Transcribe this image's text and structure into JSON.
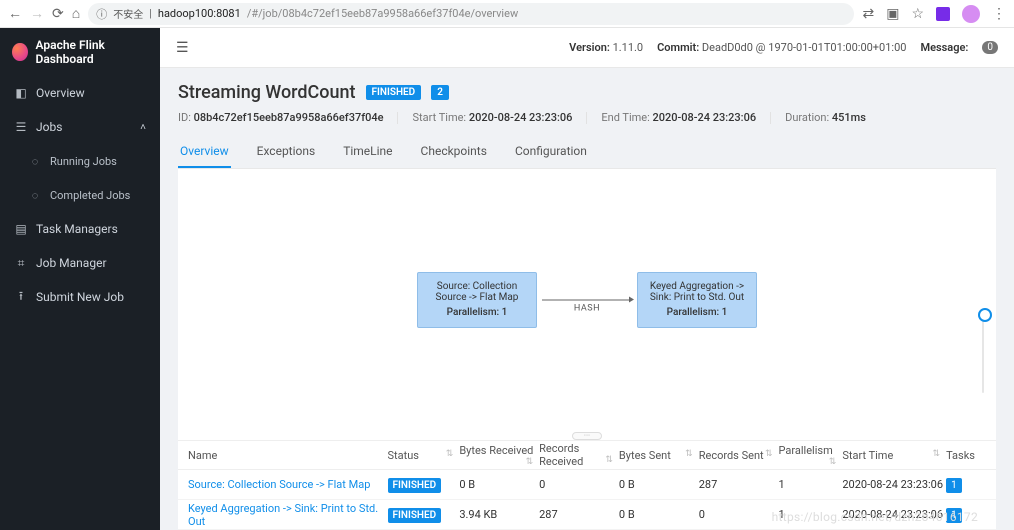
{
  "browser": {
    "insecure_label": "不安全",
    "host": "hadoop100:8081",
    "path": "/#/job/08b4c72ef15eeb87a9958a66ef37f04e/overview"
  },
  "brand": "Apache Flink Dashboard",
  "sidebar": {
    "overview": "Overview",
    "jobs": "Jobs",
    "running_jobs": "Running Jobs",
    "completed_jobs": "Completed Jobs",
    "task_managers": "Task Managers",
    "job_manager": "Job Manager",
    "submit": "Submit New Job"
  },
  "topbar": {
    "version_label": "Version:",
    "version": "1.11.0",
    "commit_label": "Commit:",
    "commit": "DeadD0d0 @ 1970-01-01T01:00:00+01:00",
    "message_label": "Message:",
    "message_count": "0"
  },
  "job": {
    "title": "Streaming WordCount",
    "status": "FINISHED",
    "count": "2",
    "id_label": "ID:",
    "id": "08b4c72ef15eeb87a9958a66ef37f04e",
    "start_label": "Start Time:",
    "start": "2020-08-24 23:23:06",
    "end_label": "End Time:",
    "end": "2020-08-24 23:23:06",
    "duration_label": "Duration:",
    "duration": "451ms"
  },
  "tabs": {
    "overview": "Overview",
    "exceptions": "Exceptions",
    "timeline": "TimeLine",
    "checkpoints": "Checkpoints",
    "configuration": "Configuration"
  },
  "graph": {
    "node1_name": "Source: Collection Source -> Flat Map",
    "node1_par_label": "Parallelism: 1",
    "edge_label": "HASH",
    "node2_name": "Keyed Aggregation -> Sink: Print to Std. Out",
    "node2_par_label": "Parallelism: 1"
  },
  "table": {
    "headers": {
      "name": "Name",
      "status": "Status",
      "bytes_received": "Bytes Received",
      "records_received": "Records Received",
      "bytes_sent": "Bytes Sent",
      "records_sent": "Records Sent",
      "parallelism": "Parallelism",
      "start_time": "Start Time",
      "tasks": "Tasks"
    },
    "rows": [
      {
        "name": "Source: Collection Source -> Flat Map",
        "status": "FINISHED",
        "br": "0 B",
        "rr": "0",
        "bs": "0 B",
        "rs": "287",
        "par": "1",
        "start": "2020-08-24 23:23:06",
        "tasks": "1"
      },
      {
        "name": "Keyed Aggregation -> Sink: Print to Std. Out",
        "status": "FINISHED",
        "br": "3.94 KB",
        "rr": "287",
        "bs": "0 B",
        "rs": "0",
        "par": "1",
        "start": "2020-08-24 23:23:06",
        "tasks": "1"
      }
    ]
  },
  "watermark": "https://blog.csdn.net/dzh284616172"
}
